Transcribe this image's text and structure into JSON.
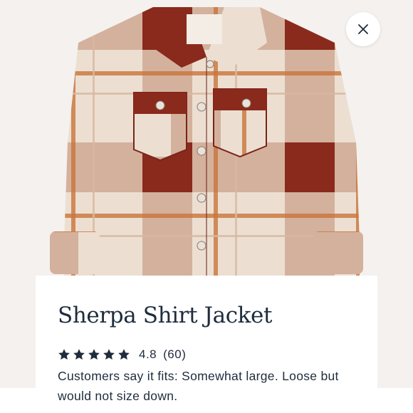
{
  "product": {
    "title": "Sherpa Shirt Jacket",
    "image_alt": "Sherpa Shirt Jacket"
  },
  "close_button": {
    "icon": "close-icon",
    "label": "Close"
  },
  "rating": {
    "value": "4.8",
    "count": "(60)",
    "stars": 4.8,
    "max_stars": 5,
    "star_color": "#1f2c3c"
  },
  "fit_summary": "Customers say it fits: Somewhat large. Loose but would not size down.",
  "colors": {
    "text": "#1f2c3c",
    "plaid_red": "#8a2a1c",
    "plaid_cream": "#efe5da"
  }
}
